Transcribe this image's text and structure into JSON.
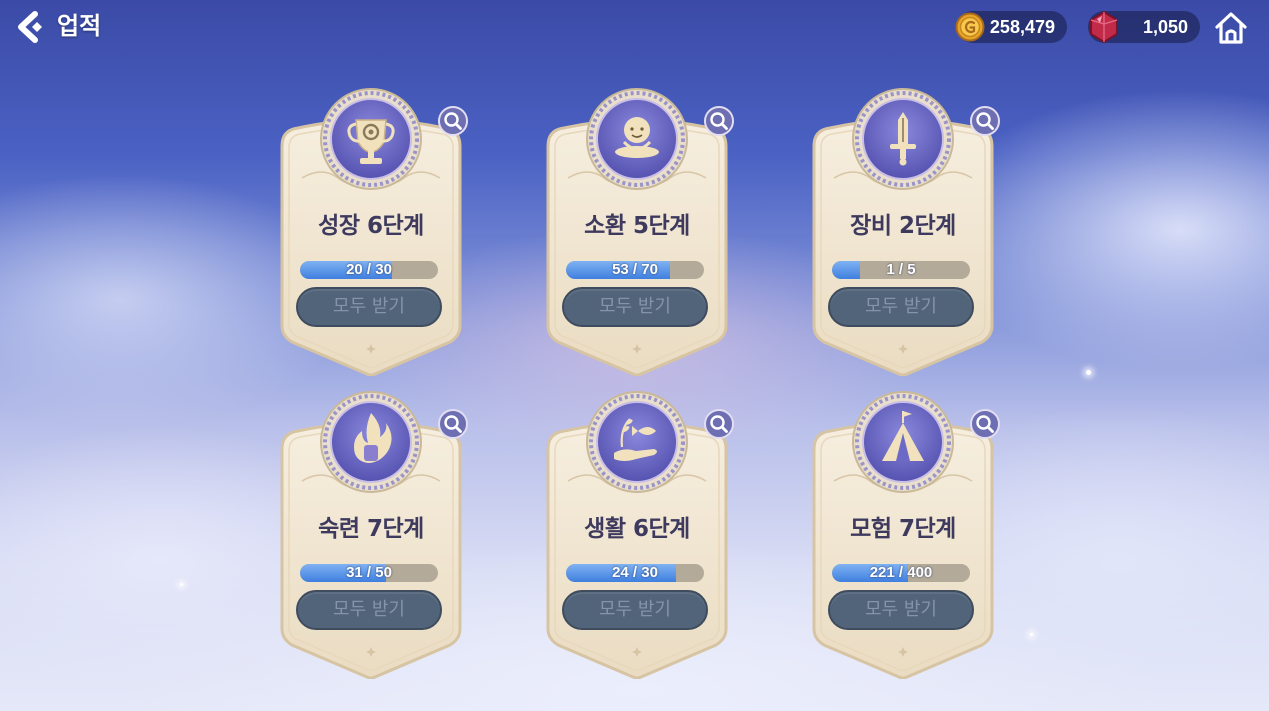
{
  "header": {
    "title": "업적",
    "back_icon": "chevron-left-icon",
    "home_icon": "home-icon"
  },
  "currencies": {
    "gold": {
      "icon": "gold-coin-icon",
      "value": "258,479"
    },
    "gem": {
      "icon": "red-gem-icon",
      "value": "1,050"
    }
  },
  "colors": {
    "card_bg": "#f3e9d8",
    "card_border": "#d8c6a6",
    "medal_inner": "#6c6ac6",
    "progress_fill": "#4a8ae6",
    "button_bg": "#52647a",
    "title_text": "#3e3a5e"
  },
  "cards": [
    {
      "title": "성장 6단계",
      "progress_text": "20 / 30",
      "current": 20,
      "total": 30,
      "button": "모두 받기",
      "icon": "trophy-icon"
    },
    {
      "title": "소환 5단계",
      "progress_text": "53 / 70",
      "current": 53,
      "total": 70,
      "button": "모두 받기",
      "icon": "summon-spirit-icon"
    },
    {
      "title": "장비 2단계",
      "progress_text": "1 / 5",
      "current": 1,
      "total": 5,
      "button": "모두 받기",
      "icon": "sword-icon"
    },
    {
      "title": "숙련 7단계",
      "progress_text": "31 / 50",
      "current": 31,
      "total": 50,
      "button": "모두 받기",
      "icon": "fist-flame-icon"
    },
    {
      "title": "생활 6단계",
      "progress_text": "24 / 30",
      "current": 24,
      "total": 30,
      "button": "모두 받기",
      "icon": "hand-fish-icon"
    },
    {
      "title": "모험 7단계",
      "progress_text": "221 / 400",
      "current": 221,
      "total": 400,
      "button": "모두 받기",
      "icon": "tent-icon"
    }
  ]
}
